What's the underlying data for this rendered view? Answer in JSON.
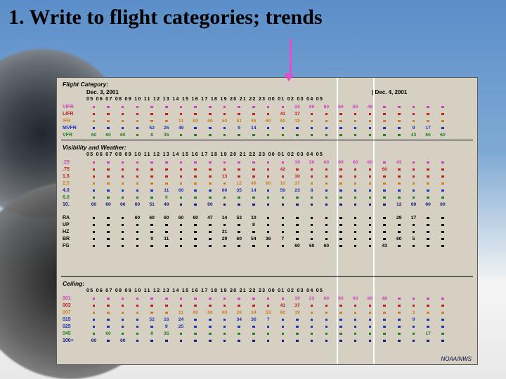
{
  "title": "1. Write to flight categories; trends",
  "dates": {
    "left": "Dec. 3, 2001",
    "right": "| Dec. 4, 2001"
  },
  "hours": "05 06 07 08 09 10 11 12 13 14 15 16 17 18 19 20 21 22 23 00 01 02 03 04 05",
  "sections": {
    "flight": {
      "label": "Flight Category:",
      "rows": [
        {
          "label": "VIFR",
          "class": "c-magenta",
          "cells": [
            "sq-m",
            "sq-m",
            "sq-m",
            "sq-m",
            "sq-m",
            "sq-m",
            "sq-m",
            "sq-m",
            "sq-m",
            "sq-m",
            "sq-m",
            "sq-m",
            "sq-m",
            "sq-m",
            "23",
            "60",
            "60",
            "60",
            "60",
            "48",
            "sq-m",
            "sq-m",
            "sq-m",
            "sq-m",
            "sq-m"
          ]
        },
        {
          "label": "LIFR",
          "class": "c-red",
          "cells": [
            "sq-r",
            "sq-r",
            "sq-r",
            "sq-r",
            "sq-r",
            "sq-r",
            "sq-r",
            "sq-r",
            "sq-r",
            "sq-r",
            "sq-r",
            "sq-r",
            "sq-r",
            "41",
            "37",
            "sq-r",
            "sq-r",
            "sq-r",
            "sq-r",
            "sq-r",
            "sq-r",
            "sq-r",
            "sq-r",
            "sq-r",
            "sq-r"
          ]
        },
        {
          "label": "IFR",
          "class": "c-orange",
          "cells": [
            "sq-o",
            "sq-o",
            "sq-o",
            "sq-o",
            "sq-o",
            "sq-o",
            "11",
            "60",
            "60",
            "50",
            "51",
            "46",
            "60",
            "60",
            "19",
            "sq-o",
            "sq-o",
            "sq-o",
            "sq-o",
            "sq-o",
            "sq-o",
            "sq-o",
            "sq-o",
            "sq-o",
            "sq-o"
          ]
        },
        {
          "label": "MVFR",
          "class": "c-blue",
          "cells": [
            "sq-b",
            "sq-b",
            "sq-b",
            "sq-b",
            "52",
            "25",
            "49",
            "sq-b",
            "sq-b",
            "sq-b",
            "9",
            "14",
            "sq-b",
            "sq-b",
            "sq-b",
            "sq-b",
            "sq-b",
            "sq-b",
            "sq-b",
            "sq-b",
            "sq-b",
            "sq-b",
            "9",
            "17",
            "sq-b"
          ]
        },
        {
          "label": "VFR",
          "class": "c-green",
          "cells": [
            "60",
            "60",
            "60",
            "sq-g",
            "8",
            "35",
            "sq-g",
            "sq-g",
            "sq-g",
            "sq-g",
            "sq-g",
            "sq-g",
            "sq-g",
            "sq-g",
            "sq-g",
            "sq-g",
            "sq-g",
            "sq-g",
            "sq-g",
            "sq-g",
            "sq-g",
            "sq-g",
            "43",
            "60",
            "60"
          ]
        }
      ]
    },
    "viswx": {
      "label": "Visibility and Weather:",
      "rows": [
        {
          "label": ".25",
          "class": "c-magenta",
          "cells": [
            "sq-m",
            "sq-m",
            "sq-m",
            "sq-m",
            "sq-m",
            "sq-m",
            "sq-m",
            "sq-m",
            "sq-m",
            "sq-m",
            "sq-m",
            "sq-m",
            "sq-m",
            "sq-m",
            "19",
            "20",
            "60",
            "60",
            "60",
            "60",
            "sq-m",
            "43",
            "sq-m",
            "sq-m",
            "sq-m"
          ]
        },
        {
          "label": ".75",
          "class": "c-red",
          "cells": [
            "sq-r",
            "sq-r",
            "sq-r",
            "sq-r",
            "sq-r",
            "sq-r",
            "sq-r",
            "sq-r",
            "sq-r",
            "sq-r",
            "sq-r",
            "sq-r",
            "sq-r",
            "42",
            "sq-r",
            "sq-r",
            "sq-r",
            "sq-r",
            "sq-r",
            "sq-r",
            "60",
            "sq-r",
            "sq-r",
            "sq-r",
            "sq-r"
          ]
        },
        {
          "label": "1.5",
          "class": "c-red",
          "cells": [
            "sq-r",
            "sq-r",
            "sq-r",
            "sq-r",
            "sq-r",
            "sq-r",
            "sq-r",
            "sq-r",
            "sq-r",
            "13",
            "sq-r",
            "sq-r",
            "sq-r",
            "sq-r",
            "10",
            "sq-r",
            "sq-r",
            "sq-r",
            "sq-r",
            "sq-r",
            "sq-r",
            "sq-r",
            "sq-r",
            "sq-r",
            "sq-r"
          ]
        },
        {
          "label": "2.5",
          "class": "c-orange",
          "cells": [
            "sq-o",
            "sq-o",
            "sq-o",
            "sq-o",
            "sq-o",
            "sq-o",
            "sq-o",
            "sq-o",
            "sq-o",
            "sq-o",
            "12",
            "46",
            "60",
            "10",
            "37",
            "sq-o",
            "sq-o",
            "sq-o",
            "sq-o",
            "sq-o",
            "sq-o",
            "sq-o",
            "sq-o",
            "sq-o",
            "sq-o"
          ]
        },
        {
          "label": "4.0",
          "class": "c-blue",
          "cells": [
            "sq-b",
            "sq-b",
            "sq-b",
            "sq-b",
            "sq-b",
            "11",
            "60",
            "sq-b",
            "sq-b",
            "60",
            "35",
            "14",
            "sq-b",
            "50",
            "23",
            "8",
            "sq-b",
            "sq-b",
            "sq-b",
            "sq-b",
            "sq-b",
            "sq-b",
            "sq-b",
            "sq-b",
            "sq-b"
          ]
        },
        {
          "label": "6.0",
          "class": "c-green",
          "cells": [
            "sq-g",
            "sq-g",
            "sq-g",
            "sq-g",
            "sq-g",
            "9",
            "sq-g",
            "sq-g",
            "sq-g",
            "sq-g",
            "sq-g",
            "sq-g",
            "sq-g",
            "sq-g",
            "sq-g",
            "sq-g",
            "sq-g",
            "sq-g",
            "sq-g",
            "sq-g",
            "sq-g",
            "sq-g",
            "sq-g",
            "sq-g",
            "sq-g"
          ]
        },
        {
          "label": "10.",
          "class": "c-navy",
          "cells": [
            "60",
            "60",
            "60",
            "60",
            "51",
            "49",
            "sq-n",
            "sq-n",
            "60",
            "sq-n",
            "sq-n",
            "sq-n",
            "sq-n",
            "sq-n",
            "sq-n",
            "sq-n",
            "sq-n",
            "sq-n",
            "sq-n",
            "sq-n",
            "sq-n",
            "12",
            "60",
            "60",
            "60"
          ]
        }
      ],
      "wxrows": [
        {
          "label": "RA",
          "cells": [
            "sq-k",
            "sq-k",
            "sq-k",
            "60",
            "60",
            "60",
            "60",
            "60",
            "47",
            "14",
            "53",
            "10",
            "sq-k",
            "sq-k",
            "sq-k",
            "sq-k",
            "sq-k",
            "sq-k",
            "sq-k",
            "sq-k",
            "sq-k",
            "29",
            "17",
            "sq-k",
            "sq-k"
          ]
        },
        {
          "label": "UP",
          "cells": [
            "sq-k",
            "sq-k",
            "sq-k",
            "sq-k",
            "sq-k",
            "sq-k",
            "sq-k",
            "sq-k",
            "sq-k",
            "sq-k",
            "sq-k",
            "8",
            "sq-k",
            "sq-k",
            "sq-k",
            "sq-k",
            "sq-k",
            "sq-k",
            "sq-k",
            "sq-k",
            "sq-k",
            "sq-k",
            "sq-k",
            "sq-k",
            "sq-k"
          ]
        },
        {
          "label": "HZ",
          "cells": [
            "sq-k",
            "sq-k",
            "sq-k",
            "sq-k",
            "sq-k",
            "sq-k",
            "sq-k",
            "sq-k",
            "sq-k",
            "31",
            "sq-k",
            "sq-k",
            "sq-k",
            "sq-k",
            "sq-k",
            "sq-k",
            "sq-k",
            "sq-k",
            "sq-k",
            "sq-k",
            "sq-k",
            "sq-k",
            "sq-k",
            "sq-k",
            "sq-k"
          ]
        },
        {
          "label": "BR",
          "cells": [
            "sq-k",
            "sq-k",
            "sq-k",
            "sq-k",
            "9",
            "11",
            "sq-k",
            "sq-k",
            "sq-k",
            "29",
            "60",
            "54",
            "36",
            "7",
            "sq-k",
            "sq-k",
            "sq-k",
            "sq-k",
            "sq-k",
            "sq-k",
            "sq-k",
            "60",
            "5",
            "sq-k",
            "sq-k"
          ]
        },
        {
          "label": "FG",
          "cells": [
            "sq-k",
            "sq-k",
            "sq-k",
            "sq-k",
            "sq-k",
            "sq-k",
            "sq-k",
            "sq-k",
            "sq-k",
            "sq-k",
            "sq-k",
            "sq-k",
            "sq-k",
            "sq-k",
            "60",
            "60",
            "60",
            "sq-k",
            "sq-k",
            "sq-k",
            "43",
            "sq-k",
            "sq-k",
            "sq-k",
            "sq-k"
          ]
        }
      ]
    },
    "ceiling": {
      "label": "Ceiling:",
      "rows": [
        {
          "label": "001",
          "class": "c-magenta",
          "cells": [
            "sq-m",
            "sq-m",
            "sq-m",
            "sq-m",
            "sq-m",
            "sq-m",
            "sq-m",
            "sq-m",
            "sq-m",
            "sq-m",
            "sq-m",
            "sq-m",
            "sq-m",
            "sq-m",
            "19",
            "23",
            "60",
            "60",
            "60",
            "60",
            "48",
            "sq-m",
            "sq-m",
            "sq-m",
            "sq-m"
          ]
        },
        {
          "label": "003",
          "class": "c-red",
          "cells": [
            "sq-r",
            "sq-r",
            "sq-r",
            "sq-r",
            "sq-r",
            "sq-r",
            "sq-r",
            "sq-r",
            "sq-r",
            "sq-r",
            "sq-r",
            "sq-r",
            "sq-r",
            "41",
            "37",
            "sq-r",
            "sq-r",
            "sq-r",
            "sq-r",
            "sq-r",
            "sq-r",
            "sq-r",
            "sq-r",
            "sq-r",
            "sq-r"
          ]
        },
        {
          "label": "007",
          "class": "c-orange",
          "cells": [
            "sq-o",
            "sq-o",
            "sq-o",
            "sq-o",
            "sq-o",
            "sq-o",
            "11",
            "60",
            "60",
            "60",
            "26",
            "24",
            "53",
            "60",
            "19",
            "sq-o",
            "sq-o",
            "sq-o",
            "sq-o",
            "sq-o",
            "sq-o",
            "sq-o",
            "3",
            "sq-o",
            "sq-o"
          ]
        },
        {
          "label": "015",
          "class": "c-blue",
          "cells": [
            "sq-b",
            "sq-b",
            "sq-b",
            "sq-b",
            "52",
            "16",
            "24",
            "sq-b",
            "sq-b",
            "sq-b",
            "34",
            "36",
            "7",
            "sq-b",
            "sq-b",
            "sq-b",
            "sq-b",
            "sq-b",
            "sq-b",
            "sq-b",
            "sq-b",
            "sq-b",
            "9",
            "sq-b",
            "sq-b"
          ]
        },
        {
          "label": "025",
          "class": "c-blue",
          "cells": [
            "sq-b",
            "sq-b",
            "sq-b",
            "sq-b",
            "sq-b",
            "9",
            "25",
            "sq-b",
            "sq-b",
            "sq-b",
            "sq-b",
            "sq-b",
            "sq-b",
            "sq-b",
            "sq-b",
            "sq-b",
            "sq-b",
            "sq-b",
            "sq-b",
            "sq-b",
            "sq-b",
            "sq-b",
            "sq-b",
            "sq-b",
            "sq-b"
          ]
        },
        {
          "label": "045",
          "class": "c-green",
          "cells": [
            "sq-g",
            "60",
            "sq-g",
            "sq-g",
            "8",
            "35",
            "sq-g",
            "sq-g",
            "sq-g",
            "sq-g",
            "sq-g",
            "sq-g",
            "sq-g",
            "sq-g",
            "sq-g",
            "sq-g",
            "sq-g",
            "sq-g",
            "sq-g",
            "sq-g",
            "sq-g",
            "sq-g",
            "sq-g",
            "17",
            "sq-g"
          ]
        },
        {
          "label": "100+",
          "class": "c-navy",
          "cells": [
            "60",
            "sq-n",
            "60",
            "sq-n",
            "sq-n",
            "sq-n",
            "sq-n",
            "sq-n",
            "sq-n",
            "sq-n",
            "sq-n",
            "sq-n",
            "sq-n",
            "sq-n",
            "sq-n",
            "sq-n",
            "sq-n",
            "sq-n",
            "sq-n",
            "sq-n",
            "sq-n",
            "sq-n",
            "sq-n",
            "sq-n",
            "sq-n"
          ]
        }
      ]
    }
  },
  "footer": "NOAA/NWS"
}
